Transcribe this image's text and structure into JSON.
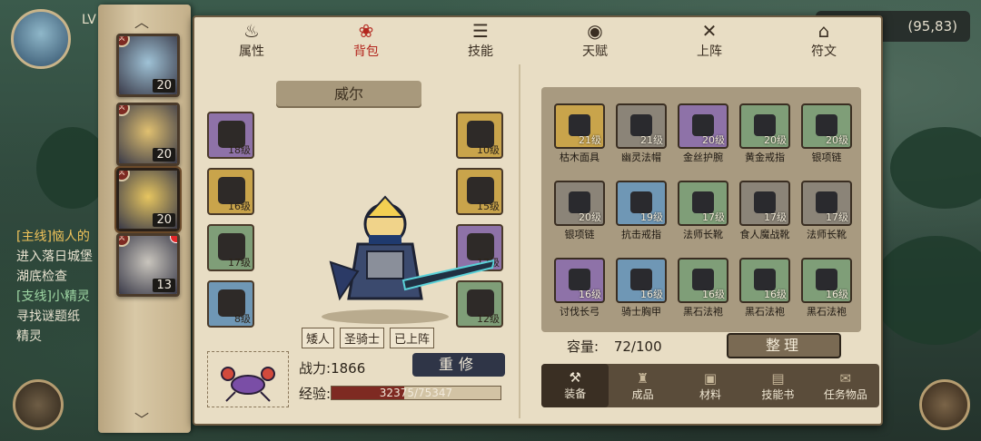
{
  "hud": {
    "level_prefix": "LV",
    "coords": "(95,83)",
    "quests": [
      {
        "type": "main",
        "title": "[主线]恼人的",
        "desc": "进入落日城堡",
        "desc2": "湖底检查"
      },
      {
        "type": "side",
        "title": "[支线]小精灵",
        "desc": "寻找谜题纸",
        "desc2": "精灵"
      }
    ]
  },
  "tabs": [
    {
      "icon": "♨",
      "label": "属性",
      "active": false
    },
    {
      "icon": "❀",
      "label": "背包",
      "active": true
    },
    {
      "icon": "☰",
      "label": "技能",
      "active": false
    },
    {
      "icon": "◉",
      "label": "天赋",
      "active": false
    },
    {
      "icon": "✕",
      "label": "上阵",
      "active": false
    },
    {
      "icon": "⌂",
      "label": "符文",
      "active": false
    }
  ],
  "heroes": [
    {
      "level": "20",
      "palette": "#9fc2d6"
    },
    {
      "level": "20",
      "palette": "#e0c070"
    },
    {
      "level": "20",
      "palette": "#e6c560",
      "selected": true
    },
    {
      "level": "13",
      "palette": "#c9c5bd",
      "notify": true
    }
  ],
  "character": {
    "name": "威尔",
    "tags": [
      "矮人",
      "圣骑士",
      "已上阵"
    ],
    "power_label": "战力:",
    "power_value": "1866",
    "rebuild_label": "重修",
    "exp_label": "经验:",
    "exp_text": "32375/75347",
    "exp_current": 32375,
    "exp_max": 75347
  },
  "equip_left": [
    {
      "level": "18级",
      "quality": "purple"
    },
    {
      "level": "16级",
      "quality": "gold"
    },
    {
      "level": "17级",
      "quality": "green"
    },
    {
      "level": "8级",
      "quality": "blue"
    }
  ],
  "equip_right": [
    {
      "level": "10级",
      "quality": "gold"
    },
    {
      "level": "15级",
      "quality": "gold"
    },
    {
      "level": "17级",
      "quality": "purple"
    },
    {
      "level": "12级",
      "quality": "green"
    }
  ],
  "inventory": [
    {
      "name": "枯木面具",
      "level": "21级",
      "quality": "gold"
    },
    {
      "name": "幽灵法帽",
      "level": "21级",
      "quality": "gray"
    },
    {
      "name": "金丝护腕",
      "level": "20级",
      "quality": "purple"
    },
    {
      "name": "黄金戒指",
      "level": "20级",
      "quality": "green"
    },
    {
      "name": "银项链",
      "level": "20级",
      "quality": "green"
    },
    {
      "name": "银项链",
      "level": "20级",
      "quality": "gray"
    },
    {
      "name": "抗击戒指",
      "level": "19级",
      "quality": "blue"
    },
    {
      "name": "法师长靴",
      "level": "17级",
      "quality": "green"
    },
    {
      "name": "食人魔战靴",
      "level": "17级",
      "quality": "gray"
    },
    {
      "name": "法师长靴",
      "level": "17级",
      "quality": "gray"
    },
    {
      "name": "讨伐长弓",
      "level": "16级",
      "quality": "purple"
    },
    {
      "name": "骑士胸甲",
      "level": "16级",
      "quality": "blue"
    },
    {
      "name": "黑石法袍",
      "level": "16级",
      "quality": "green"
    },
    {
      "name": "黑石法袍",
      "level": "16级",
      "quality": "green"
    },
    {
      "name": "黑石法袍",
      "level": "16级",
      "quality": "green"
    },
    {
      "name": "",
      "level": "",
      "quality": "gray"
    },
    {
      "name": "",
      "level": "",
      "quality": "blue"
    },
    {
      "name": "",
      "level": "",
      "quality": "green"
    },
    {
      "name": "",
      "level": "",
      "quality": "green"
    },
    {
      "name": "",
      "level": "",
      "quality": "gray"
    }
  ],
  "capacity": {
    "label": "容量:",
    "value": "72/100",
    "used": 72,
    "max": 100
  },
  "sort_label": "整理",
  "categories": [
    {
      "icon": "⚒",
      "label": "装备",
      "active": true
    },
    {
      "icon": "♜",
      "label": "成品",
      "active": false
    },
    {
      "icon": "▣",
      "label": "材料",
      "active": false
    },
    {
      "icon": "▤",
      "label": "技能书",
      "active": false
    },
    {
      "icon": "✉",
      "label": "任务物品",
      "active": false
    }
  ]
}
